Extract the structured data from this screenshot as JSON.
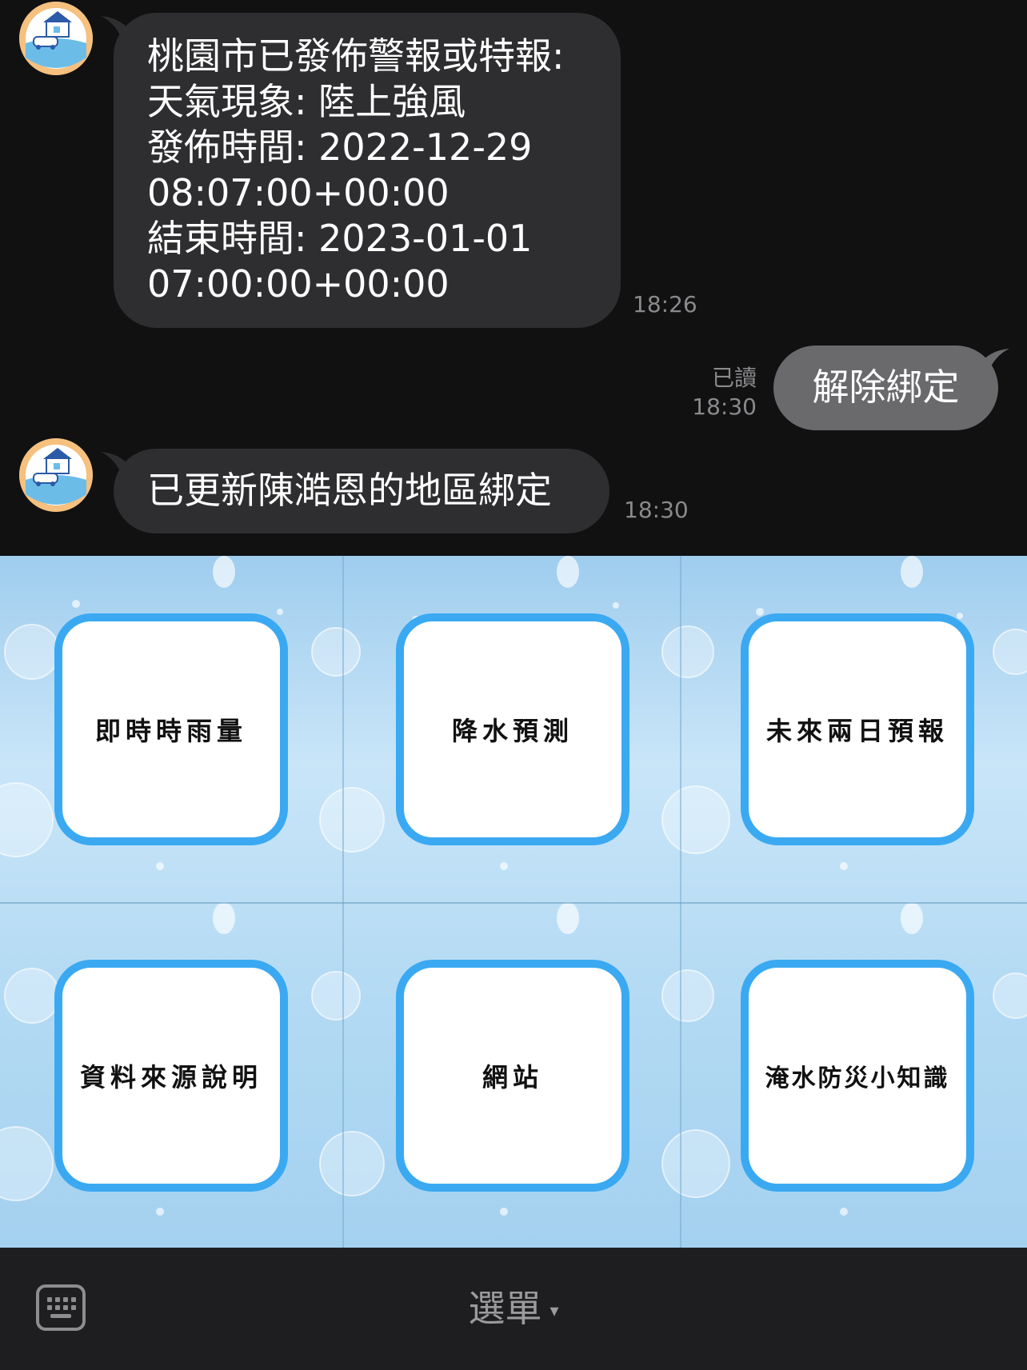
{
  "conversation": {
    "messages": [
      {
        "id": "m1",
        "sender": "bot",
        "text": "桃園市已發佈警報或特報:\n天氣現象: 陸上強風\n發佈時間: 2022-12-29\n08:07:00+00:00\n結束時間: 2023-01-01\n07:00:00+00:00",
        "time": "18:26"
      },
      {
        "id": "m2",
        "sender": "user",
        "text": "解除綁定",
        "status": "已讀",
        "time": "18:30"
      },
      {
        "id": "m3",
        "sender": "bot",
        "text": "已更新陳澔恩的地區綁定",
        "time": "18:30"
      }
    ]
  },
  "rich_menu": {
    "items": [
      {
        "label": "即時時雨量"
      },
      {
        "label": "降水預測"
      },
      {
        "label": "未來兩日預報"
      },
      {
        "label": "資料來源說明"
      },
      {
        "label": "網站"
      },
      {
        "label": "淹水防災小知識"
      }
    ]
  },
  "bottom_bar": {
    "menu_label": "選單",
    "menu_arrow": "▾",
    "keyboard_icon": "keyboard-icon"
  },
  "colors": {
    "background": "#111112",
    "bot_bubble": "#2e2e30",
    "user_bubble": "#6a6a6d",
    "card_border": "#3aa9f2",
    "bottom_bar": "#1e1e20"
  }
}
